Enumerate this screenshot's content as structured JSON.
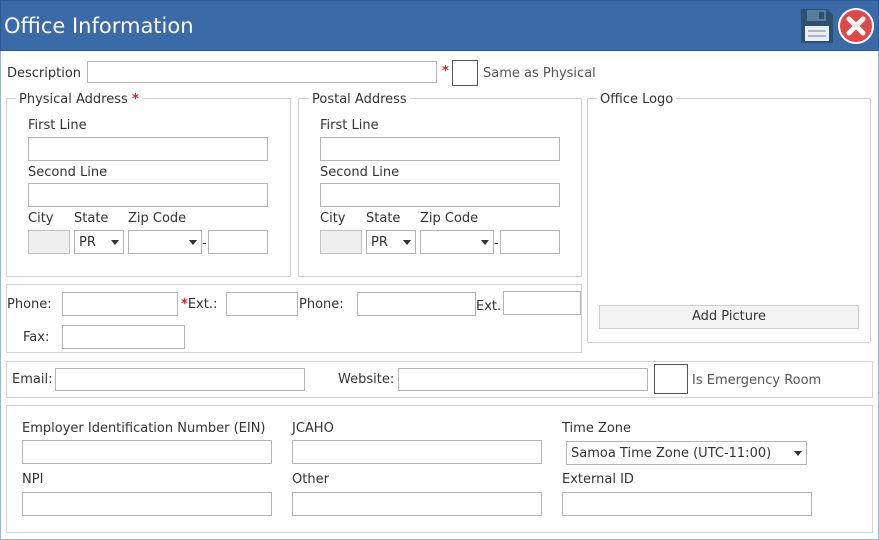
{
  "window": {
    "title": "Office Information"
  },
  "toolbar": {
    "save_icon": "save-icon",
    "close_icon": "close-icon"
  },
  "description": {
    "label": "Description",
    "value": "",
    "same_as_physical_label": "Same as Physical",
    "same_as_physical_checked": false
  },
  "physical": {
    "legend": "Physical Address",
    "first_line_label": "First Line",
    "second_line_label": "Second Line",
    "city_label": "City",
    "state_label": "State",
    "zip_label": "Zip Code",
    "state_value": "PR",
    "zip_sep": "-"
  },
  "postal": {
    "legend": "Postal Address",
    "first_line_label": "First Line",
    "second_line_label": "Second Line",
    "city_label": "City",
    "state_label": "State",
    "zip_label": "Zip Code",
    "state_value": "PR",
    "zip_sep": "-"
  },
  "logo": {
    "legend": "Office Logo",
    "add_picture_label": "Add Picture"
  },
  "phones": {
    "phone1_label": "Phone:",
    "ext1_label": "Ext.:",
    "phone2_label": "Phone:",
    "ext2_label": "Ext.",
    "fax_label": "Fax:"
  },
  "contact": {
    "email_label": "Email:",
    "website_label": "Website:",
    "emergency_label": "Is Emergency Room",
    "emergency_checked": false
  },
  "ids": {
    "ein_label": "Employer Identification Number (EIN)",
    "jcaho_label": "JCAHO",
    "timezone_label": "Time Zone",
    "timezone_value": "Samoa Time Zone (UTC-11:00)",
    "npi_label": "NPI",
    "other_label": "Other",
    "external_id_label": "External ID"
  },
  "colors": {
    "titlebar": "#3b6aa8",
    "required": "#e02020",
    "close_button": "#e04848"
  }
}
